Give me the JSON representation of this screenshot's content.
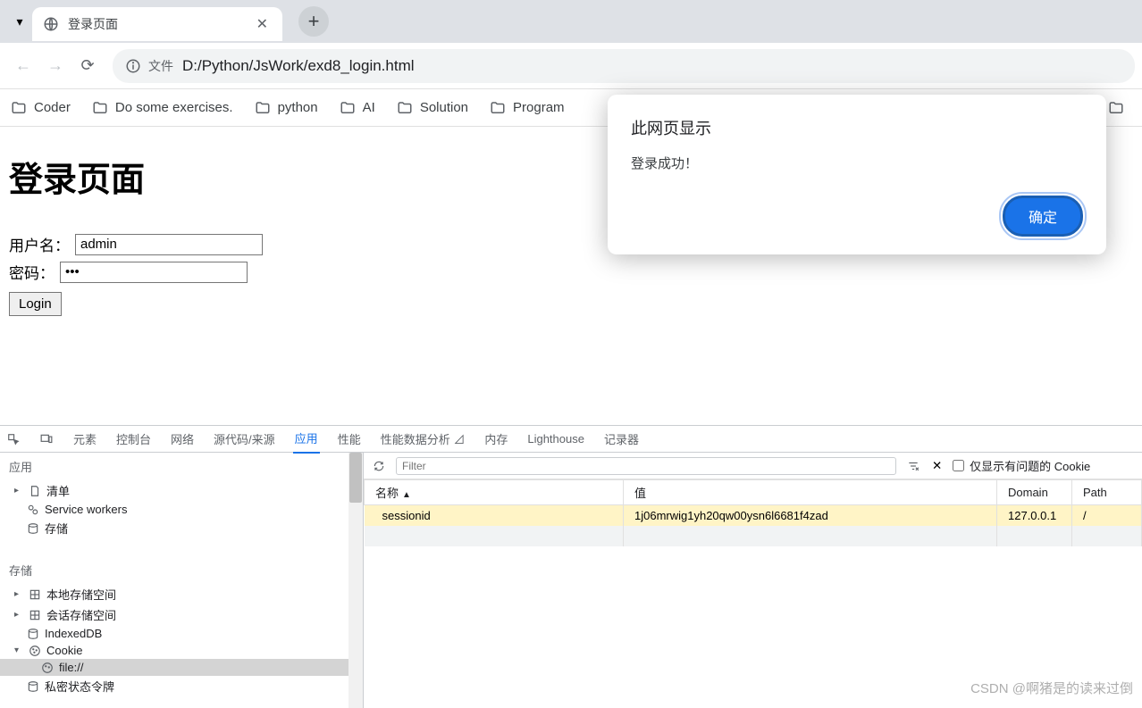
{
  "browser": {
    "tab_title": "登录页面",
    "url_file_label": "文件",
    "url_text": "D:/Python/JsWork/exd8_login.html",
    "bookmarks": [
      "Coder",
      "Do some exercises.",
      "python",
      "AI",
      "Solution",
      "Program"
    ]
  },
  "page": {
    "heading": "登录页面",
    "username_label": "用户名：",
    "username_value": "admin",
    "password_label": "密码：",
    "password_value": "•••",
    "login_button": "Login"
  },
  "alert": {
    "title": "此网页显示",
    "message": "登录成功！",
    "ok": "确定"
  },
  "devtools": {
    "tabs": [
      "元素",
      "控制台",
      "网络",
      "源代码/来源",
      "应用",
      "性能",
      "性能数据分析 ⊿",
      "内存",
      "Lighthouse",
      "记录器"
    ],
    "active_tab": "应用",
    "sidebar": {
      "section_app": "应用",
      "manifest": "清单",
      "service_workers": "Service workers",
      "storage": "存储",
      "section_storage": "存储",
      "local_storage": "本地存储空间",
      "session_storage": "会话存储空间",
      "indexeddb": "IndexedDB",
      "cookie": "Cookie",
      "cookie_file": "file://",
      "private_token": "私密状态令牌"
    },
    "filter_placeholder": "Filter",
    "only_problem_label": "仅显示有问题的 Cookie",
    "table": {
      "headers": [
        "名称",
        "值",
        "Domain",
        "Path"
      ],
      "row": {
        "name": "sessionid",
        "value": "1j06mrwig1yh20qw00ysn6l6681f4zad",
        "domain": "127.0.0.1",
        "path": "/"
      }
    }
  },
  "watermark": "CSDN @啊猪是的读来过倒"
}
